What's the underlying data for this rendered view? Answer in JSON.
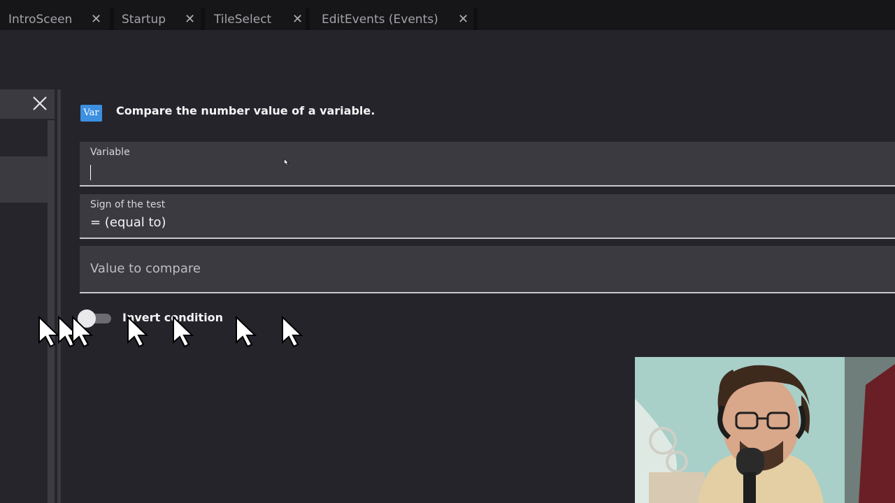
{
  "tabs": [
    {
      "label": "IntroSceen"
    },
    {
      "label": "Startup"
    },
    {
      "label": "TileSelect"
    },
    {
      "label": "EditEvents (Events)"
    }
  ],
  "condition": {
    "icon_text": "Var",
    "description": "Compare the number value of a variable."
  },
  "fields": {
    "variable": {
      "label": "Variable",
      "value": ""
    },
    "sign": {
      "label": "Sign of the test",
      "value": "= (equal to)"
    },
    "compare": {
      "placeholder": "Value to compare"
    }
  },
  "invert": {
    "label": "Invert condition",
    "checked": false
  },
  "colors": {
    "background": "#25242b",
    "tabbar": "#161619",
    "field_bg": "#3b3a41",
    "accent": "#3d8fe0"
  }
}
